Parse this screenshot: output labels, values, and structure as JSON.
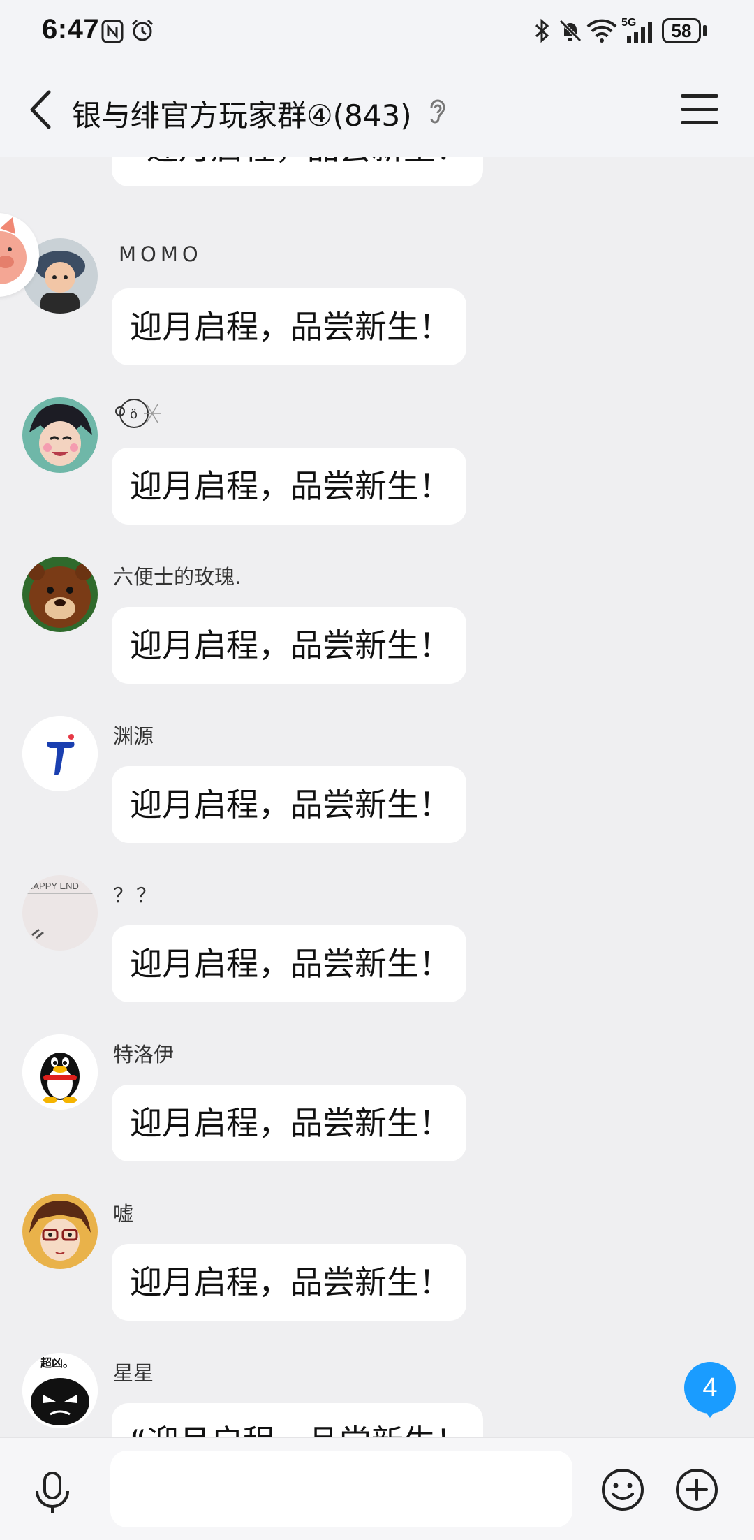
{
  "status_bar": {
    "time": "6:47",
    "battery": "58",
    "network": "5G",
    "icons": [
      "nfc-icon",
      "alarm-icon",
      "bluetooth-icon",
      "mute-icon",
      "wifi-icon",
      "signal-icon",
      "battery-icon"
    ]
  },
  "header": {
    "title": "银与绯官方玩家群④(843)",
    "back_icon": "chevron-left-icon",
    "ear_icon": "ear-icon",
    "menu_icon": "hamburger-icon"
  },
  "messages": [
    {
      "sender": "",
      "text": "“迎月启程，品尝新生！",
      "avatar": "none"
    },
    {
      "sender": "MOMO",
      "text": "迎月启程，品尝新生！",
      "avatar": "toddler-photo"
    },
    {
      "sender": "",
      "text": "迎月启程，品尝新生！",
      "avatar": "anime-boy"
    },
    {
      "sender": "六便士的玫瑰.",
      "text": "迎月启程，品尝新生！",
      "avatar": "cartoon-bear"
    },
    {
      "sender": "渊源",
      "text": "迎月启程，品尝新生！",
      "avatar": "letter-t-logo"
    },
    {
      "sender": "？？",
      "text": "迎月启程，品尝新生！",
      "avatar": "happy-end-photo"
    },
    {
      "sender": "特洛伊",
      "text": "迎月启程，品尝新生！",
      "avatar": "qq-penguin"
    },
    {
      "sender": "嘘",
      "text": "迎月启程，品尝新生！",
      "avatar": "anime-glasses"
    },
    {
      "sender": "星星",
      "text": "“迎月启程，品尝新生！",
      "avatar": "black-mascot"
    }
  ],
  "avatar_texts": {
    "happy_end": "HAPPY END",
    "black_mascot": "超凶。"
  },
  "unread_badge": "4",
  "input": {
    "placeholder": "",
    "value": ""
  },
  "colors": {
    "accent": "#1a9cff",
    "background": "#efeff1",
    "bubble": "#ffffff"
  }
}
